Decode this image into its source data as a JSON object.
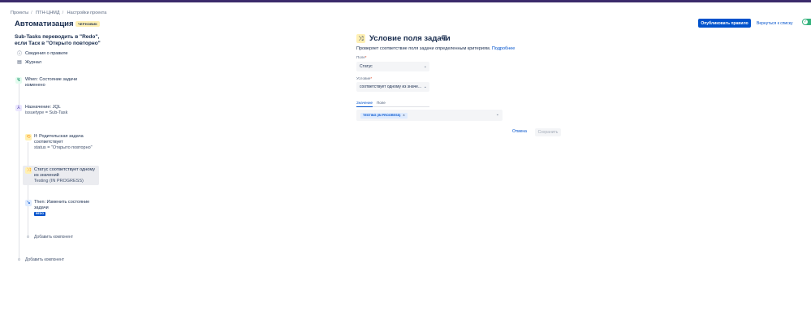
{
  "breadcrumb": [
    "Проекты",
    "ПТН-ЦНМД",
    "Настройки проекта"
  ],
  "breadcrumb_separator": "/",
  "page_title": "Автоматизация",
  "draft_badge": "ЧЕРНОВИК",
  "rule_name": "Sub-Tasks переводить в \"Redo\", если Таск в \"Открыто повторно\"",
  "sidebar_links": [
    {
      "label": "Сведения о правиле",
      "icon": "info-icon"
    },
    {
      "label": "Журнал",
      "icon": "journal-icon"
    }
  ],
  "steps": {
    "when": {
      "title": "When: Состояние задачи изменено"
    },
    "branch": {
      "title": "Назначение: JQL",
      "sub": "issuetype = Sub-Task"
    },
    "if": {
      "title": "If: Родительская задача соответствует",
      "sub": "status = \"Открыто повторно\""
    },
    "condition": {
      "title": "Статус соответствует одному из значений",
      "sub": "Testing (IN PROGRESS)"
    },
    "then": {
      "title": "Then: Изменить состояние задачи",
      "badge": "REDO"
    }
  },
  "add_component_inner": "Добавить компонент",
  "add_component_outer": "Добавить компонент",
  "panel": {
    "title": "Условие поля задачи",
    "description": "Проверяет соответствие поля задачи определенным критериям.",
    "more_link": "Подробнее",
    "field_label": "Поле",
    "field_value": "Статус",
    "condition_label": "Условие",
    "condition_value": "соответствует одному из значе...",
    "required_mark": "*",
    "tabs": [
      "Значение",
      "Поле"
    ],
    "chip": "TESTING (IN PROGRESS)",
    "cancel_label": "Отмена",
    "save_label": "Сохранить"
  },
  "header": {
    "publish_label": "Опубликовать правило",
    "back_label": "Вернуться к списку"
  },
  "colors": {
    "accent": "#0052cc",
    "badge_bg": "#fff0b3",
    "toggle_on": "#36b37e"
  }
}
